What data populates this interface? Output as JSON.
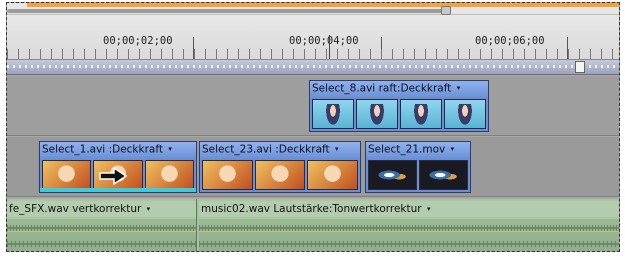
{
  "ruler": {
    "timecodes": [
      "00;00;02;00",
      "00;00;04;00",
      "00;00;06;00"
    ]
  },
  "video_track_2": {
    "clips": [
      {
        "label": "Select_8.avi",
        "effect": "raft:Deckkraft",
        "dropdown": "▾"
      }
    ]
  },
  "video_track_1": {
    "clips": [
      {
        "label": "Select_1.avi",
        "effect": ":Deckkraft",
        "dropdown": "▾"
      },
      {
        "label": "Select_23.avi",
        "effect": ":Deckkraft",
        "dropdown": "▾"
      },
      {
        "label": "Select_21.mov",
        "effect": "",
        "dropdown": "▾"
      }
    ]
  },
  "audio_track_1": {
    "clips": [
      {
        "label": "fe_SFX.wav",
        "effect": "vertkorrektur",
        "dropdown": "▾"
      },
      {
        "label": "music02.wav",
        "effect": "Lautstärke:Tonwertkorrektur",
        "dropdown": "▾"
      }
    ]
  },
  "colors": {
    "clip_header": "#7aa0e2",
    "accent_orange": "#f3a33a",
    "audio_track": "#a7c1a1",
    "transition_band": "#3ecbdc"
  },
  "icons": [
    "transition-arrow-icon",
    "dropdown-icon",
    "playhead-icon"
  ]
}
